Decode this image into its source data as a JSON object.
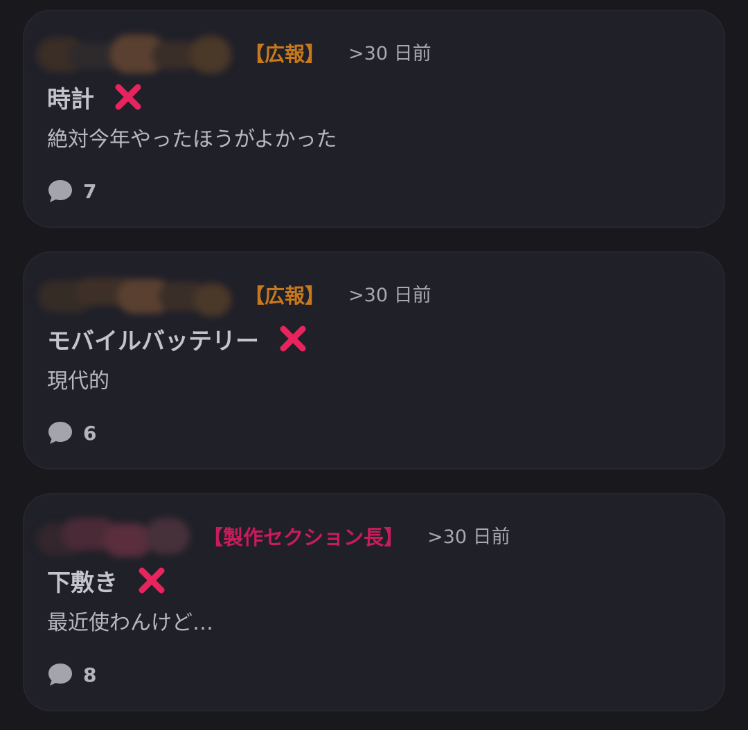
{
  "posts": [
    {
      "badge": "【広報】",
      "badge_color": "#c9791b",
      "timestamp": ">30 日前",
      "title": "時計",
      "body": "絶対今年やったほうがよかった",
      "comment_count": "7",
      "avatar_blur_color": "#4a3a2e"
    },
    {
      "badge": "【広報】",
      "badge_color": "#c9791b",
      "timestamp": ">30 日前",
      "title": "モバイルバッテリー",
      "body": "現代的",
      "comment_count": "6",
      "avatar_blur_color": "#4a3a2e"
    },
    {
      "badge": "【製作セクション長】",
      "badge_color": "#c81c5c",
      "timestamp": ">30 日前",
      "title": "下敷き",
      "body": "最近使わんけど…",
      "comment_count": "8",
      "avatar_blur_color": "#4a2a38"
    }
  ],
  "icons": {
    "reaction": "cross-mark-icon",
    "comments": "speech-bubble-icon"
  },
  "colors": {
    "background": "#18181d",
    "card": "#202029",
    "cross_mark": "#e8245e"
  }
}
